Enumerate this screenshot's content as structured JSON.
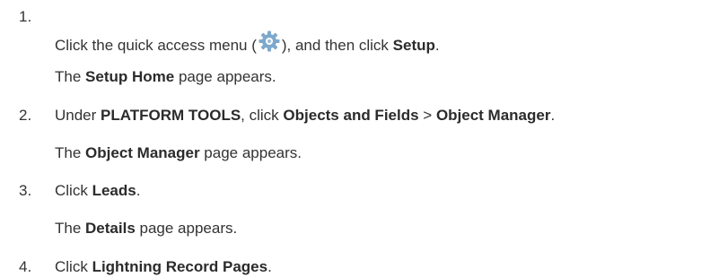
{
  "steps": [
    {
      "number": "1.",
      "instruction": {
        "pre": "Click the quick access menu (",
        "icon": "gear-icon",
        "mid": "), and then click ",
        "bold": "Setup",
        "post": "."
      },
      "result": {
        "pre": "The ",
        "bold": "Setup Home",
        "post": " page appears."
      }
    },
    {
      "number": "2.",
      "instruction": {
        "pre": "Under ",
        "bold1": "PLATFORM TOOLS",
        "mid1": ", click ",
        "bold2": "Objects and Fields",
        "mid2": " > ",
        "bold3": "Object Manager",
        "post": "."
      },
      "result": {
        "pre": "The ",
        "bold": "Object Manager",
        "post": " page appears."
      }
    },
    {
      "number": "3.",
      "instruction": {
        "pre": "Click ",
        "bold": "Leads",
        "post": "."
      },
      "result": {
        "pre": "The ",
        "bold": "Details",
        "post": " page appears."
      }
    },
    {
      "number": "4.",
      "instruction": {
        "pre": "Click ",
        "bold": "Lightning Record Pages",
        "post": "."
      }
    }
  ],
  "colors": {
    "text": "#333333",
    "icon_gear": "#6f9fc7"
  }
}
